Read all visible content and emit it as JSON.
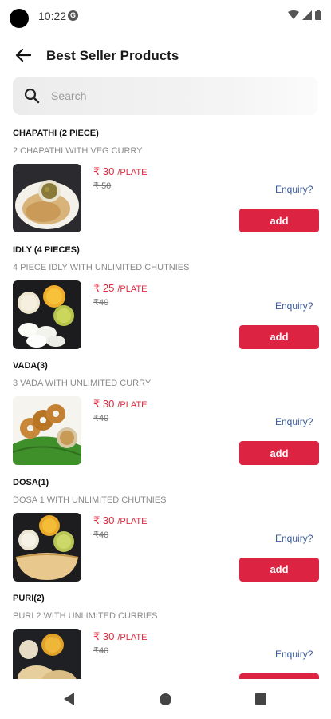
{
  "status_bar": {
    "time": "10:22"
  },
  "header": {
    "title": "Best Seller Products",
    "back_icon": "arrow-left-icon"
  },
  "search": {
    "placeholder": "Search",
    "value": ""
  },
  "currency": "₹",
  "products": [
    {
      "name": "CHAPATHI (2 PIECE)",
      "description": "2 CHAPATHI WITH VEG CURRY",
      "price": "30",
      "unit": "/PLATE",
      "old_price": "50",
      "enquiry": "Enquiry?",
      "add": "add"
    },
    {
      "name": "IDLY (4 PIECES)",
      "description": "4 PIECE IDLY WITH UNLIMITED CHUTNIES",
      "price": "25",
      "unit": "/PLATE",
      "old_price": "40",
      "enquiry": "Enquiry?",
      "add": "add"
    },
    {
      "name": "VADA(3)",
      "description": "3 VADA WITH UNLIMITED CURRY",
      "price": "30",
      "unit": "/PLATE",
      "old_price": "40",
      "enquiry": "Enquiry?",
      "add": "add"
    },
    {
      "name": "DOSA(1)",
      "description": "DOSA 1 WITH UNLIMITED CHUTNIES",
      "price": "30",
      "unit": "/PLATE",
      "old_price": "40",
      "enquiry": "Enquiry?",
      "add": "add"
    },
    {
      "name": "PURI(2)",
      "description": "PURI 2 WITH UNLIMITED CURRIES",
      "price": "30",
      "unit": "/PLATE",
      "old_price": "40",
      "enquiry": "Enquiry?",
      "add": "add"
    }
  ],
  "colors": {
    "accent": "#dc2442",
    "price": "#e0293f",
    "link": "#3a5a9a"
  }
}
